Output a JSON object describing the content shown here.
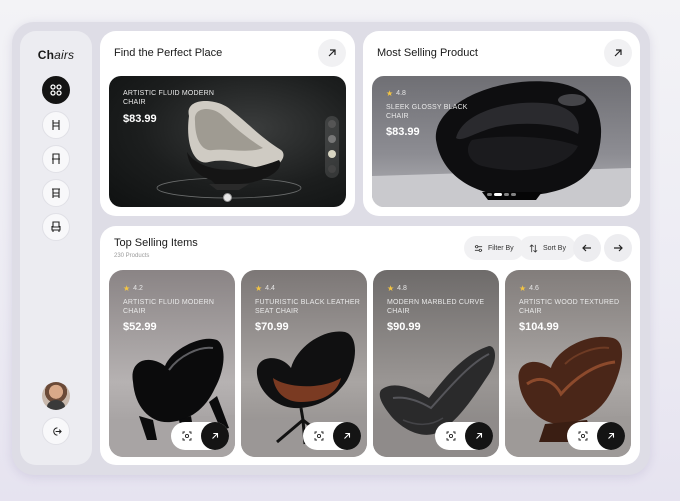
{
  "sidebar": {
    "logo_prefix": "Ch",
    "logo_suffix": "airs",
    "nav": [
      {
        "icon": "grid-icon",
        "active": true
      },
      {
        "icon": "chair-icon",
        "active": false
      },
      {
        "icon": "dining-chair-icon",
        "active": false
      },
      {
        "icon": "stool-icon",
        "active": false
      },
      {
        "icon": "armchair-icon",
        "active": false
      }
    ]
  },
  "find_card": {
    "title": "Find the Perfect Place",
    "product_name": "ARTISTIC FLUID  MODERN CHAIR",
    "price": "$83.99"
  },
  "most_selling": {
    "title": "Most Selling Product",
    "rating": "4.8",
    "product_name": "SLEEK GLOSSY BLACK CHAIR",
    "price": "$83.99"
  },
  "top_selling": {
    "title": "Top Selling Items",
    "count": "230 Products",
    "filter_label": "Filter By",
    "sort_label": "Sort By",
    "products": [
      {
        "rating": "4.2",
        "name": "ARTISTIC FLUID  MODERN CHAIR",
        "price": "$52.99"
      },
      {
        "rating": "4.4",
        "name": "FUTURISTIC  BLACK LEATHER SEAT CHAIR",
        "price": "$70.99"
      },
      {
        "rating": "4.8",
        "name": "MODERN MARBLED CURVE CHAIR",
        "price": "$90.99"
      },
      {
        "rating": "4.6",
        "name": "ARTISTIC WOOD TEXTURED CHAIR",
        "price": "$104.99"
      }
    ]
  },
  "colors": {
    "accent": "#141414",
    "star": "#f4c542",
    "card": "#ffffff",
    "background": "#dedde6"
  }
}
